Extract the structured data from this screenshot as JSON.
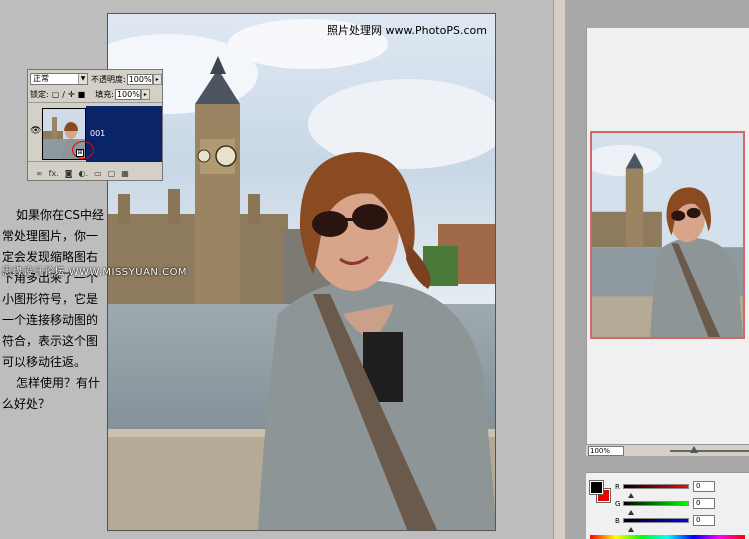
{
  "watermark": {
    "text": "照片处理网 www.PhotoPS.com"
  },
  "watermark2": {
    "prefix": "思缘设计论坛",
    "site": "WWW.MISSYUAN.COM"
  },
  "description": {
    "p1": "如果你在CS中经常处理图片，你一定会发现缩略图右下角多出来了一个小图形符号，它是一个连接移动图的符合，表示这个图可以移动往返。",
    "p2": "怎样使用？有什么好处？"
  },
  "layers_panel": {
    "blend_mode": "正常",
    "opacity_label": "不透明度:",
    "opacity_value": "100%",
    "lock_label": "锁定:",
    "fill_label": "填充:",
    "fill_value": "100%",
    "layer_name": "001",
    "footer_icons": [
      "link-icon",
      "fx-icon",
      "mask-icon",
      "adjustment-icon",
      "folder-icon",
      "new-layer-icon",
      "trash-icon"
    ],
    "footer_glyphs": [
      "∞",
      "fx.",
      "◙",
      "◐.",
      "▭",
      "▢",
      "🗑"
    ]
  },
  "navigator": {
    "zoom_value": "100%"
  },
  "color_panel": {
    "foreground": "#000000",
    "background": "#ee0000",
    "channels": [
      {
        "label": "R",
        "value": "0",
        "gradient": "linear-gradient(to right,#000,#f00)"
      },
      {
        "label": "G",
        "value": "0",
        "gradient": "linear-gradient(to right,#000,#0f0)"
      },
      {
        "label": "B",
        "value": "0",
        "gradient": "linear-gradient(to right,#000,#00f)"
      }
    ]
  }
}
